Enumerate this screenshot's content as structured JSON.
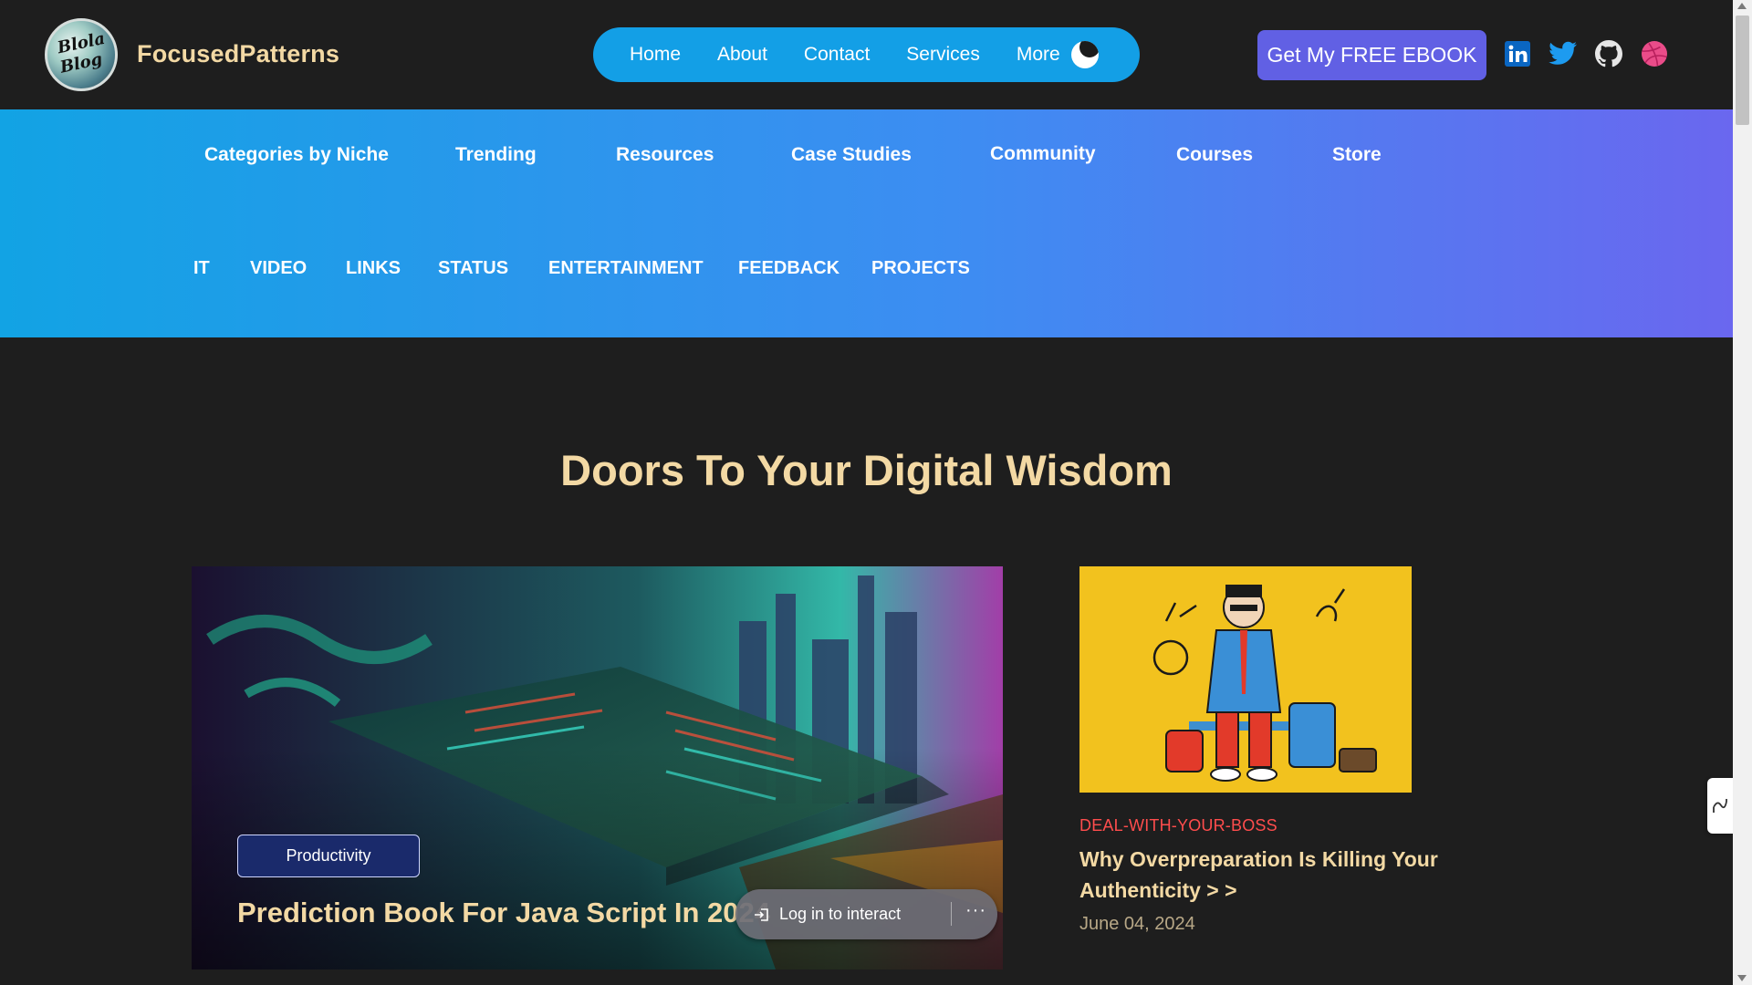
{
  "site": {
    "brand": "FocusedPatterns",
    "logo_text": [
      "Blola",
      "Blog"
    ]
  },
  "main_nav": {
    "home": "Home",
    "about": "About",
    "contact": "Contact",
    "services": "Services",
    "more": "More"
  },
  "cta_label": "Get My FREE EBOOK",
  "social_icons": [
    "linkedin-icon",
    "twitter-icon",
    "github-icon",
    "dribbble-icon"
  ],
  "categories": [
    "Categories by Niche",
    "Trending",
    "Resources",
    "Case Studies",
    "Community",
    "Courses",
    "Store"
  ],
  "tags": [
    "IT",
    "VIDEO",
    "LINKS",
    "STATUS",
    "ENTERTAINMENT",
    "FEEDBACK",
    "PROJECTS"
  ],
  "hero": {
    "heading": "Doors To Your Digital Wisdom"
  },
  "featured_post": {
    "category": "Productivity",
    "title": "Prediction Book For Java Script In 2024"
  },
  "login_overlay": {
    "label": "Log in to interact",
    "menu": "···"
  },
  "side_post": {
    "category": "DEAL-WITH-YOUR-BOSS",
    "title": "Why Overpreparation Is Killing Your Authenticity > >",
    "date": "June 04, 2024"
  },
  "colors": {
    "background": "#1e1e1e",
    "accent_blue": "#139fe6",
    "accent_purple": "#6160e4",
    "heading_gold": "#f3d9a4",
    "category_red": "#ff4d4d",
    "band_gradient": [
      "#12a3e4",
      "#6a67ef"
    ]
  }
}
